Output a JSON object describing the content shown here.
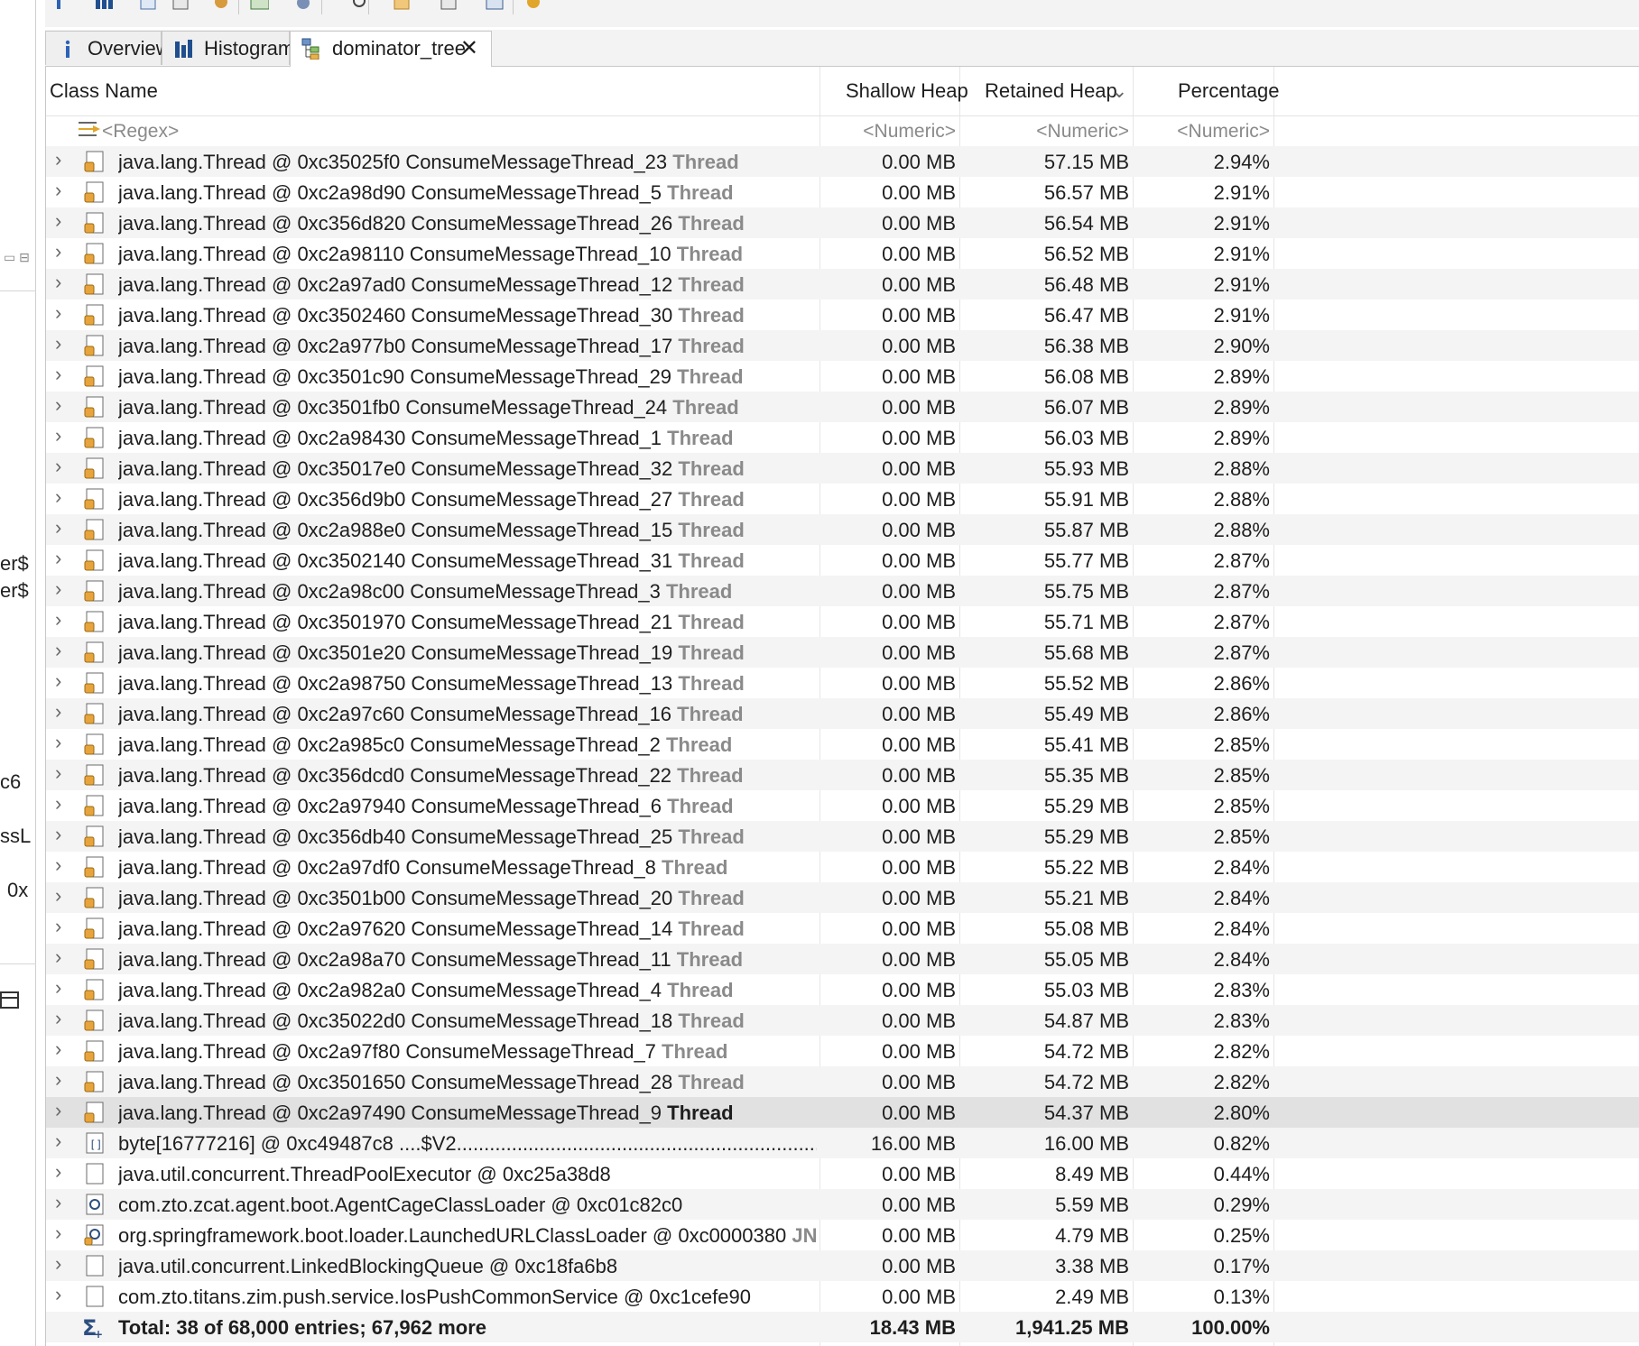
{
  "left_panel_fragments": [
    "er$",
    "er$",
    "c6",
    "ssL",
    "0x"
  ],
  "tabs": [
    {
      "label": "Overview",
      "icon": "info-icon"
    },
    {
      "label": "Histogram",
      "icon": "histogram-icon"
    },
    {
      "label": "dominator_tree",
      "icon": "dominator-tree-icon",
      "active": true
    }
  ],
  "columns": {
    "class_name": "Class Name",
    "shallow_heap": "Shallow Heap",
    "retained_heap": "Retained Heap",
    "percentage": "Percentage"
  },
  "filters": {
    "class_name": "<Regex>",
    "shallow_heap": "<Numeric>",
    "retained_heap": "<Numeric>",
    "percentage": "<Numeric>"
  },
  "rows": [
    {
      "name": "java.lang.Thread @ 0xc35025f0  ConsumeMessageThread_23",
      "tag": "Thread",
      "shallow": "0.00 MB",
      "retained": "57.15 MB",
      "pct": "2.94%",
      "icon": "thread-object-icon"
    },
    {
      "name": "java.lang.Thread @ 0xc2a98d90  ConsumeMessageThread_5",
      "tag": "Thread",
      "shallow": "0.00 MB",
      "retained": "56.57 MB",
      "pct": "2.91%",
      "icon": "thread-object-icon"
    },
    {
      "name": "java.lang.Thread @ 0xc356d820  ConsumeMessageThread_26",
      "tag": "Thread",
      "shallow": "0.00 MB",
      "retained": "56.54 MB",
      "pct": "2.91%",
      "icon": "thread-object-icon"
    },
    {
      "name": "java.lang.Thread @ 0xc2a98110  ConsumeMessageThread_10",
      "tag": "Thread",
      "shallow": "0.00 MB",
      "retained": "56.52 MB",
      "pct": "2.91%",
      "icon": "thread-object-icon"
    },
    {
      "name": "java.lang.Thread @ 0xc2a97ad0  ConsumeMessageThread_12",
      "tag": "Thread",
      "shallow": "0.00 MB",
      "retained": "56.48 MB",
      "pct": "2.91%",
      "icon": "thread-object-icon"
    },
    {
      "name": "java.lang.Thread @ 0xc3502460  ConsumeMessageThread_30",
      "tag": "Thread",
      "shallow": "0.00 MB",
      "retained": "56.47 MB",
      "pct": "2.91%",
      "icon": "thread-object-icon"
    },
    {
      "name": "java.lang.Thread @ 0xc2a977b0  ConsumeMessageThread_17",
      "tag": "Thread",
      "shallow": "0.00 MB",
      "retained": "56.38 MB",
      "pct": "2.90%",
      "icon": "thread-object-icon"
    },
    {
      "name": "java.lang.Thread @ 0xc3501c90  ConsumeMessageThread_29",
      "tag": "Thread",
      "shallow": "0.00 MB",
      "retained": "56.08 MB",
      "pct": "2.89%",
      "icon": "thread-object-icon"
    },
    {
      "name": "java.lang.Thread @ 0xc3501fb0  ConsumeMessageThread_24",
      "tag": "Thread",
      "shallow": "0.00 MB",
      "retained": "56.07 MB",
      "pct": "2.89%",
      "icon": "thread-object-icon"
    },
    {
      "name": "java.lang.Thread @ 0xc2a98430  ConsumeMessageThread_1",
      "tag": "Thread",
      "shallow": "0.00 MB",
      "retained": "56.03 MB",
      "pct": "2.89%",
      "icon": "thread-object-icon"
    },
    {
      "name": "java.lang.Thread @ 0xc35017e0  ConsumeMessageThread_32",
      "tag": "Thread",
      "shallow": "0.00 MB",
      "retained": "55.93 MB",
      "pct": "2.88%",
      "icon": "thread-object-icon"
    },
    {
      "name": "java.lang.Thread @ 0xc356d9b0  ConsumeMessageThread_27",
      "tag": "Thread",
      "shallow": "0.00 MB",
      "retained": "55.91 MB",
      "pct": "2.88%",
      "icon": "thread-object-icon"
    },
    {
      "name": "java.lang.Thread @ 0xc2a988e0  ConsumeMessageThread_15",
      "tag": "Thread",
      "shallow": "0.00 MB",
      "retained": "55.87 MB",
      "pct": "2.88%",
      "icon": "thread-object-icon"
    },
    {
      "name": "java.lang.Thread @ 0xc3502140  ConsumeMessageThread_31",
      "tag": "Thread",
      "shallow": "0.00 MB",
      "retained": "55.77 MB",
      "pct": "2.87%",
      "icon": "thread-object-icon"
    },
    {
      "name": "java.lang.Thread @ 0xc2a98c00  ConsumeMessageThread_3",
      "tag": "Thread",
      "shallow": "0.00 MB",
      "retained": "55.75 MB",
      "pct": "2.87%",
      "icon": "thread-object-icon"
    },
    {
      "name": "java.lang.Thread @ 0xc3501970  ConsumeMessageThread_21",
      "tag": "Thread",
      "shallow": "0.00 MB",
      "retained": "55.71 MB",
      "pct": "2.87%",
      "icon": "thread-object-icon"
    },
    {
      "name": "java.lang.Thread @ 0xc3501e20  ConsumeMessageThread_19",
      "tag": "Thread",
      "shallow": "0.00 MB",
      "retained": "55.68 MB",
      "pct": "2.87%",
      "icon": "thread-object-icon"
    },
    {
      "name": "java.lang.Thread @ 0xc2a98750  ConsumeMessageThread_13",
      "tag": "Thread",
      "shallow": "0.00 MB",
      "retained": "55.52 MB",
      "pct": "2.86%",
      "icon": "thread-object-icon"
    },
    {
      "name": "java.lang.Thread @ 0xc2a97c60  ConsumeMessageThread_16",
      "tag": "Thread",
      "shallow": "0.00 MB",
      "retained": "55.49 MB",
      "pct": "2.86%",
      "icon": "thread-object-icon"
    },
    {
      "name": "java.lang.Thread @ 0xc2a985c0  ConsumeMessageThread_2",
      "tag": "Thread",
      "shallow": "0.00 MB",
      "retained": "55.41 MB",
      "pct": "2.85%",
      "icon": "thread-object-icon"
    },
    {
      "name": "java.lang.Thread @ 0xc356dcd0  ConsumeMessageThread_22",
      "tag": "Thread",
      "shallow": "0.00 MB",
      "retained": "55.35 MB",
      "pct": "2.85%",
      "icon": "thread-object-icon"
    },
    {
      "name": "java.lang.Thread @ 0xc2a97940  ConsumeMessageThread_6",
      "tag": "Thread",
      "shallow": "0.00 MB",
      "retained": "55.29 MB",
      "pct": "2.85%",
      "icon": "thread-object-icon"
    },
    {
      "name": "java.lang.Thread @ 0xc356db40  ConsumeMessageThread_25",
      "tag": "Thread",
      "shallow": "0.00 MB",
      "retained": "55.29 MB",
      "pct": "2.85%",
      "icon": "thread-object-icon"
    },
    {
      "name": "java.lang.Thread @ 0xc2a97df0  ConsumeMessageThread_8",
      "tag": "Thread",
      "shallow": "0.00 MB",
      "retained": "55.22 MB",
      "pct": "2.84%",
      "icon": "thread-object-icon"
    },
    {
      "name": "java.lang.Thread @ 0xc3501b00  ConsumeMessageThread_20",
      "tag": "Thread",
      "shallow": "0.00 MB",
      "retained": "55.21 MB",
      "pct": "2.84%",
      "icon": "thread-object-icon"
    },
    {
      "name": "java.lang.Thread @ 0xc2a97620  ConsumeMessageThread_14",
      "tag": "Thread",
      "shallow": "0.00 MB",
      "retained": "55.08 MB",
      "pct": "2.84%",
      "icon": "thread-object-icon"
    },
    {
      "name": "java.lang.Thread @ 0xc2a98a70  ConsumeMessageThread_11",
      "tag": "Thread",
      "shallow": "0.00 MB",
      "retained": "55.05 MB",
      "pct": "2.84%",
      "icon": "thread-object-icon"
    },
    {
      "name": "java.lang.Thread @ 0xc2a982a0  ConsumeMessageThread_4",
      "tag": "Thread",
      "shallow": "0.00 MB",
      "retained": "55.03 MB",
      "pct": "2.83%",
      "icon": "thread-object-icon"
    },
    {
      "name": "java.lang.Thread @ 0xc35022d0  ConsumeMessageThread_18",
      "tag": "Thread",
      "shallow": "0.00 MB",
      "retained": "54.87 MB",
      "pct": "2.83%",
      "icon": "thread-object-icon"
    },
    {
      "name": "java.lang.Thread @ 0xc2a97f80  ConsumeMessageThread_7",
      "tag": "Thread",
      "shallow": "0.00 MB",
      "retained": "54.72 MB",
      "pct": "2.82%",
      "icon": "thread-object-icon"
    },
    {
      "name": "java.lang.Thread @ 0xc3501650  ConsumeMessageThread_28",
      "tag": "Thread",
      "shallow": "0.00 MB",
      "retained": "54.72 MB",
      "pct": "2.82%",
      "icon": "thread-object-icon"
    },
    {
      "name": "java.lang.Thread @ 0xc2a97490  ConsumeMessageThread_9",
      "tag": "Thread",
      "shallow": "0.00 MB",
      "retained": "54.37 MB",
      "pct": "2.80%",
      "icon": "thread-object-icon",
      "selected": true
    },
    {
      "name": "byte[16777216] @ 0xc49487c8  ....$V2...........................................................................",
      "tag": "",
      "shallow": "16.00 MB",
      "retained": "16.00 MB",
      "pct": "0.82%",
      "icon": "array-object-icon"
    },
    {
      "name": "java.util.concurrent.ThreadPoolExecutor @ 0xc25a38d8",
      "tag": "",
      "shallow": "0.00 MB",
      "retained": "8.49 MB",
      "pct": "0.44%",
      "icon": "object-icon"
    },
    {
      "name": "com.zto.zcat.agent.boot.AgentCageClassLoader @ 0xc01c82c0",
      "tag": "",
      "shallow": "0.00 MB",
      "retained": "5.59 MB",
      "pct": "0.29%",
      "icon": "classloader-icon"
    },
    {
      "name": "org.springframework.boot.loader.LaunchedURLClassLoader @ 0xc0000380",
      "tag": "JNI Global",
      "shallow": "0.00 MB",
      "retained": "4.79 MB",
      "pct": "0.25%",
      "icon": "gc-root-classloader-icon"
    },
    {
      "name": "java.util.concurrent.LinkedBlockingQueue @ 0xc18fa6b8",
      "tag": "",
      "shallow": "0.00 MB",
      "retained": "3.38 MB",
      "pct": "0.17%",
      "icon": "object-icon"
    },
    {
      "name": "com.zto.titans.zim.push.service.IosPushCommonService @ 0xc1cefe90",
      "tag": "",
      "shallow": "0.00 MB",
      "retained": "2.49 MB",
      "pct": "0.13%",
      "icon": "object-icon"
    }
  ],
  "total": {
    "label": "Total: 38 of 68,000 entries; 67,962 more",
    "shallow": "18.43 MB",
    "retained": "1,941.25 MB",
    "pct": "100.00%"
  }
}
